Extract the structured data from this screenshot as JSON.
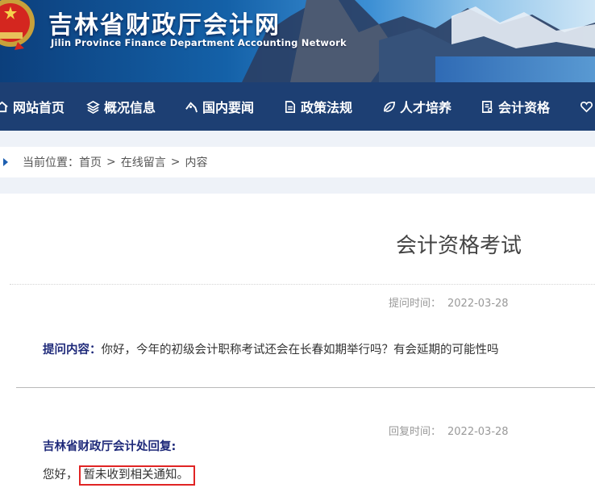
{
  "header": {
    "title": "吉林省财政厅会计网",
    "subtitle": "Jilin Province Finance Department Accounting Network"
  },
  "nav": {
    "items": [
      {
        "label": "网站首页",
        "icon": "home-icon"
      },
      {
        "label": "概况信息",
        "icon": "layers-icon"
      },
      {
        "label": "国内要闻",
        "icon": "tag-icon"
      },
      {
        "label": "政策法规",
        "icon": "document-icon"
      },
      {
        "label": "人才培养",
        "icon": "leaf-icon"
      },
      {
        "label": "会计资格",
        "icon": "certificate-icon"
      },
      {
        "label": "",
        "icon": "heart-icon"
      }
    ]
  },
  "breadcrumb": {
    "prefix": "当前位置：",
    "items": [
      "首页",
      "在线留言",
      "内容"
    ],
    "separator": ">"
  },
  "article": {
    "title": "会计资格考试",
    "question": {
      "time_label": "提问时间：",
      "time": "2022-03-28",
      "label": "提问内容：",
      "text": "你好，今年的初级会计职称考试还会在长春如期举行吗？有会延期的可能性吗"
    },
    "reply": {
      "time_label": "回复时间：",
      "time": "2022-03-28",
      "label": "吉林省财政厅会计处回复:",
      "greeting": "您好，",
      "text": "暂未收到相关通知。"
    }
  },
  "colors": {
    "nav_bg": "#1d3f73",
    "label_color": "#1f2a7a",
    "highlight_border": "#e02424"
  }
}
